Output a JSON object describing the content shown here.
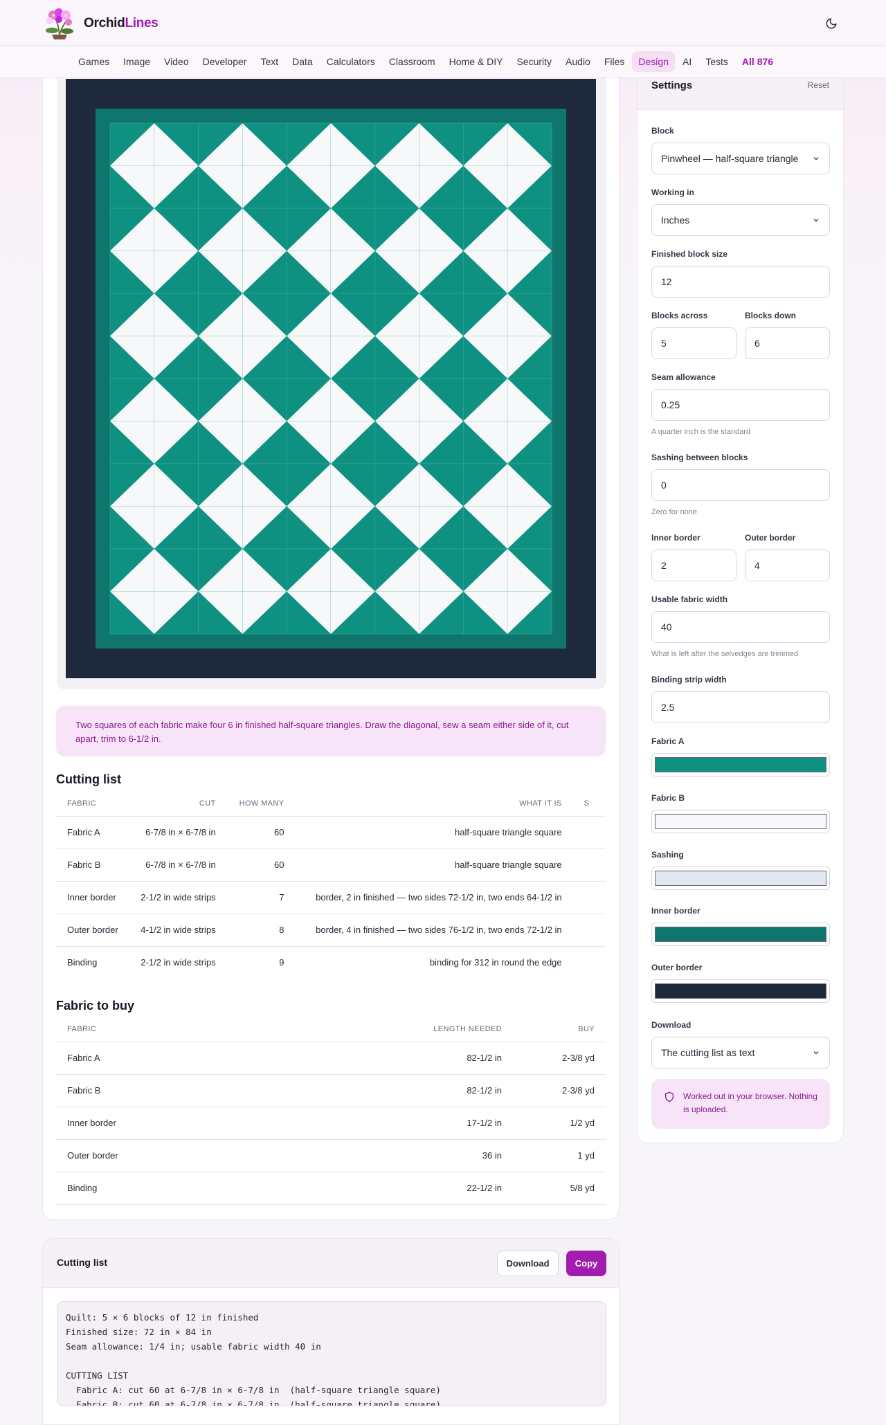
{
  "brand": {
    "name_part1": "Orchid",
    "name_part2": "Lines",
    "logo_icon": "orchid-flower-icon"
  },
  "header": {
    "theme_toggle_icon": "moon-icon"
  },
  "nav": {
    "items": [
      "Games",
      "Image",
      "Video",
      "Developer",
      "Text",
      "Data",
      "Calculators",
      "Classroom",
      "Home & DIY",
      "Security",
      "Audio",
      "Files",
      "Design",
      "AI",
      "Tests"
    ],
    "active": "Design",
    "all_label": "All 876"
  },
  "colors": {
    "accent": "#a21caf",
    "fabric_a": "#0f9182",
    "fabric_b": "#f7f8fa",
    "sashing": "#e2e8f0",
    "inner_border": "#0f766e",
    "outer_border": "#1e293b"
  },
  "quilt": {
    "blocks_across": 5,
    "blocks_down": 6
  },
  "note": "Two squares of each fabric make four 6 in finished half-square triangles. Draw the diagonal, sew a seam either side of it, cut apart, trim to 6-1/2 in.",
  "cutting": {
    "title": "Cutting list",
    "headers": [
      "FABRIC",
      "CUT",
      "HOW MANY",
      "WHAT IT IS",
      "S"
    ],
    "rows": [
      [
        "Fabric A",
        "6-7/8 in × 6-7/8 in",
        "60",
        "half-square triangle square"
      ],
      [
        "Fabric B",
        "6-7/8 in × 6-7/8 in",
        "60",
        "half-square triangle square"
      ],
      [
        "Inner border",
        "2-1/2 in wide strips",
        "7",
        "border, 2 in finished — two sides 72-1/2 in, two ends 64-1/2 in"
      ],
      [
        "Outer border",
        "4-1/2 in wide strips",
        "8",
        "border, 4 in finished — two sides 76-1/2 in, two ends 72-1/2 in"
      ],
      [
        "Binding",
        "2-1/2 in wide strips",
        "9",
        "binding for 312 in round the edge"
      ]
    ]
  },
  "fabric_buy": {
    "title": "Fabric to buy",
    "headers": [
      "FABRIC",
      "LENGTH NEEDED",
      "BUY"
    ],
    "rows": [
      [
        "Fabric A",
        "82-1/2 in",
        "2-3/8 yd"
      ],
      [
        "Fabric B",
        "82-1/2 in",
        "2-3/8 yd"
      ],
      [
        "Inner border",
        "17-1/2 in",
        "1/2 yd"
      ],
      [
        "Outer border",
        "36 in",
        "1 yd"
      ],
      [
        "Binding",
        "22-1/2 in",
        "5/8 yd"
      ]
    ]
  },
  "output": {
    "title": "Cutting list",
    "download_label": "Download",
    "copy_label": "Copy",
    "text": "Quilt: 5 × 6 blocks of 12 in finished\nFinished size: 72 in × 84 in\nSeam allowance: 1/4 in; usable fabric width 40 in\n\nCUTTING LIST\n  Fabric A: cut 60 at 6-7/8 in × 6-7/8 in  (half-square triangle square)\n  Fabric B: cut 60 at 6-7/8 in × 6-7/8 in  (half-square triangle square)"
  },
  "settings": {
    "title": "Settings",
    "reset_label": "Reset",
    "block_label": "Block",
    "block_value": "Pinwheel — half-square triangle",
    "units_label": "Working in",
    "units_value": "Inches",
    "finished_size_label": "Finished block size",
    "finished_size_value": "12",
    "across_label": "Blocks across",
    "across_value": "5",
    "down_label": "Blocks down",
    "down_value": "6",
    "seam_label": "Seam allowance",
    "seam_value": "0.25",
    "seam_hint": "A quarter inch is the standard",
    "sashing_label": "Sashing between blocks",
    "sashing_value": "0",
    "sashing_hint": "Zero for none",
    "inner_label": "Inner border",
    "inner_value": "2",
    "outer_label": "Outer border",
    "outer_value": "4",
    "width_label": "Usable fabric width",
    "width_value": "40",
    "width_hint": "What is left after the selvedges are trimmed",
    "binding_label": "Binding strip width",
    "binding_value": "2.5",
    "fabric_a_label": "Fabric A",
    "fabric_b_label": "Fabric B",
    "sashing_color_label": "Sashing",
    "inner_color_label": "Inner border",
    "outer_color_label": "Outer border",
    "download_label": "Download",
    "download_value": "The cutting list as text",
    "privacy_icon": "shield-icon",
    "privacy_text": "Worked out in your browser. Nothing is uploaded."
  }
}
